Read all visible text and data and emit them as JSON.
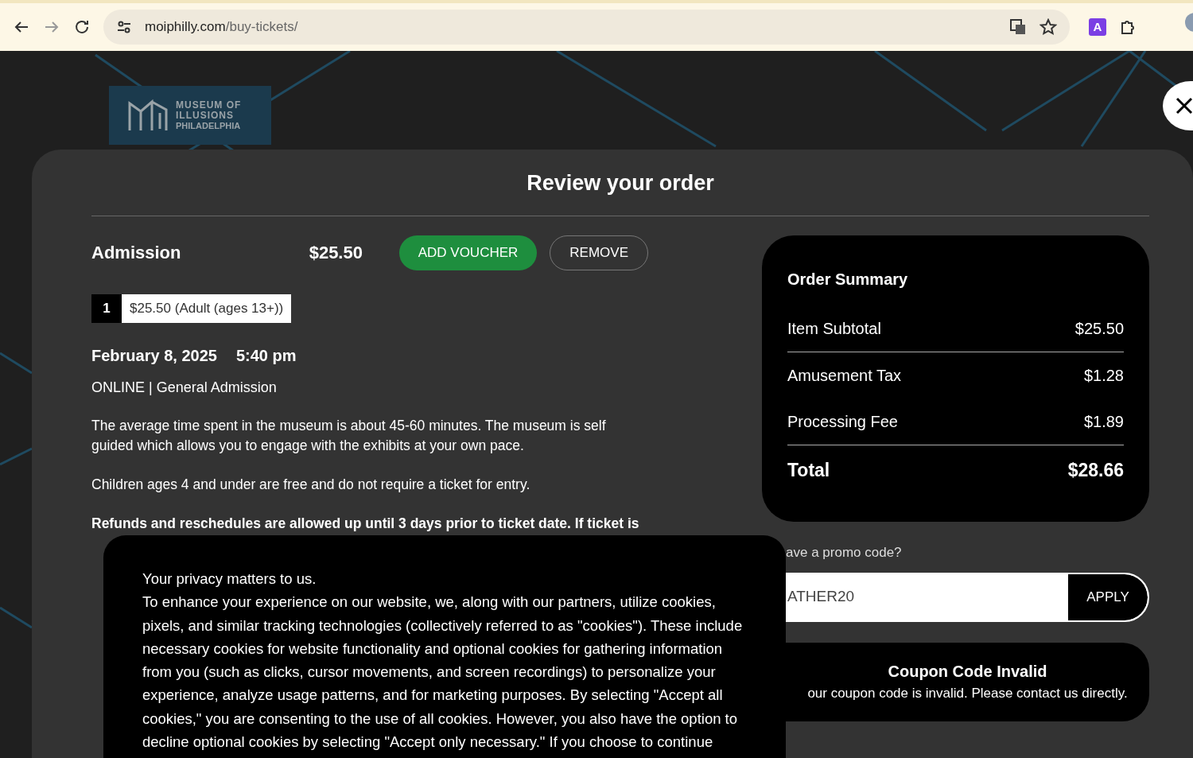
{
  "browser": {
    "url_domain": "moiphilly.com",
    "url_path": "/buy-tickets/",
    "extension_letter": "A"
  },
  "logo": {
    "lines": [
      "MUSEUM OF",
      "ILLUSIONS",
      "PHILADELPHIA"
    ]
  },
  "order": {
    "title": "Review your order",
    "item": {
      "name": "Admission",
      "price": "$25.50",
      "buttons": [
        {
          "label": "ADD VOUCHER",
          "kind": "primary"
        },
        {
          "label": "REMOVE",
          "kind": "outline"
        }
      ],
      "ticket": {
        "quantity": "1",
        "label": "$25.50 (Adult (ages 13+))"
      },
      "date": "February 8, 2025",
      "time": "5:40 pm",
      "type": "ONLINE | General Admission",
      "paragraphs": [
        {
          "text": "The average time spent in the museum is about 45-60 minutes. The museum is self guided which allows you to engage with the exhibits at your own pace.",
          "bold": false
        },
        {
          "text": "Children ages 4 and under are free and do not require a ticket for entry.",
          "bold": false
        },
        {
          "text": "Refunds and reschedules are allowed up until 3 days prior to ticket date. If ticket is",
          "bold": true
        }
      ]
    }
  },
  "summary": {
    "title": "Order Summary",
    "rows": [
      {
        "label": "Item Subtotal",
        "value": "$25.50",
        "kind": "line",
        "divided": true
      },
      {
        "label": "Amusement Tax",
        "value": "$1.28",
        "kind": "line",
        "divided": false
      },
      {
        "label": "Processing Fee",
        "value": "$1.89",
        "kind": "line",
        "divided": true
      },
      {
        "label": "Total",
        "value": "$28.66",
        "kind": "total",
        "divided": false
      }
    ]
  },
  "promo": {
    "label": "ave a promo code?",
    "value": "ATHER20",
    "button": "APPLY"
  },
  "coupon": {
    "title": "Coupon Code Invalid",
    "message": "our coupon code is invalid. Please contact us directly."
  },
  "cookie": {
    "title": "Your privacy matters to us.",
    "text": "To enhance your experience on our website, we, along with our partners, utilize cookies, pixels, and similar tracking technologies (collectively referred to as \"cookies\"). These include necessary cookies for website functionality and optional cookies for gathering information from you (such as clicks, cursor movements, and screen recordings) to personalize your experience, analyze usage patterns, and for marketing purposes. By selecting \"Accept all cookies,\" you are consenting to the use of all cookies. However, you also have the option to decline optional cookies by selecting \"Accept only necessary.\" If you choose to continue"
  }
}
